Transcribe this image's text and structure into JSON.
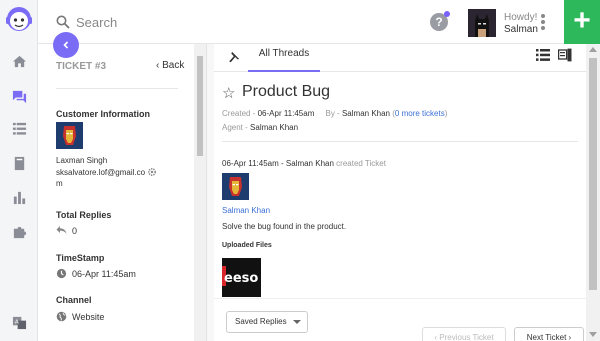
{
  "colors": {
    "accent": "#7b6cf6",
    "add_button": "#2eb85c",
    "link": "#3c6fd6"
  },
  "rail": {
    "icons": [
      "home-icon",
      "chat-icon",
      "list-icon",
      "book-icon",
      "bar-chart-icon",
      "puzzle-icon",
      "translate-icon"
    ],
    "active": "chat-icon"
  },
  "header": {
    "search_placeholder": "Search",
    "help_symbol": "?",
    "greeting": "Howdy!",
    "user_name": "Salman",
    "add_symbol": "+"
  },
  "ticket_panel": {
    "ticket_number": "TICKET #3",
    "back_label": "Back",
    "customer_heading": "Customer Information",
    "customer_name": "Laxman Singh",
    "customer_email_line1": "sksalvatore.lof@gmail.co",
    "customer_email_line2": "m",
    "total_replies_heading": "Total Replies",
    "total_replies": "0",
    "timestamp_heading": "TimeStamp",
    "timestamp": "06-Apr 11:45am",
    "channel_heading": "Channel",
    "channel": "Website"
  },
  "thread": {
    "tab_label": "All Threads",
    "title": "Product Bug",
    "created_label": "Created -",
    "created_value": "06-Apr 11:45am",
    "by_label": "By -",
    "by_value": "Salman Khan",
    "more_tickets_open": "(",
    "more_tickets_link": "0 more tickets",
    "more_tickets_close": ")",
    "agent_label": "Agent -",
    "agent_value": "Salman Khan",
    "message_header": "06-Apr 11:45am - Salman Khan",
    "message_action": "created Ticket",
    "message_author": "Salman Khan",
    "message_body": "Solve the bug found in the product.",
    "files_label": "Uploaded Files",
    "file_thumb_text": "eeso"
  },
  "footer": {
    "saved_replies_label": "Saved Replies",
    "previous_label": "‹ Previous Ticket",
    "next_label": "Next Ticket ›"
  }
}
